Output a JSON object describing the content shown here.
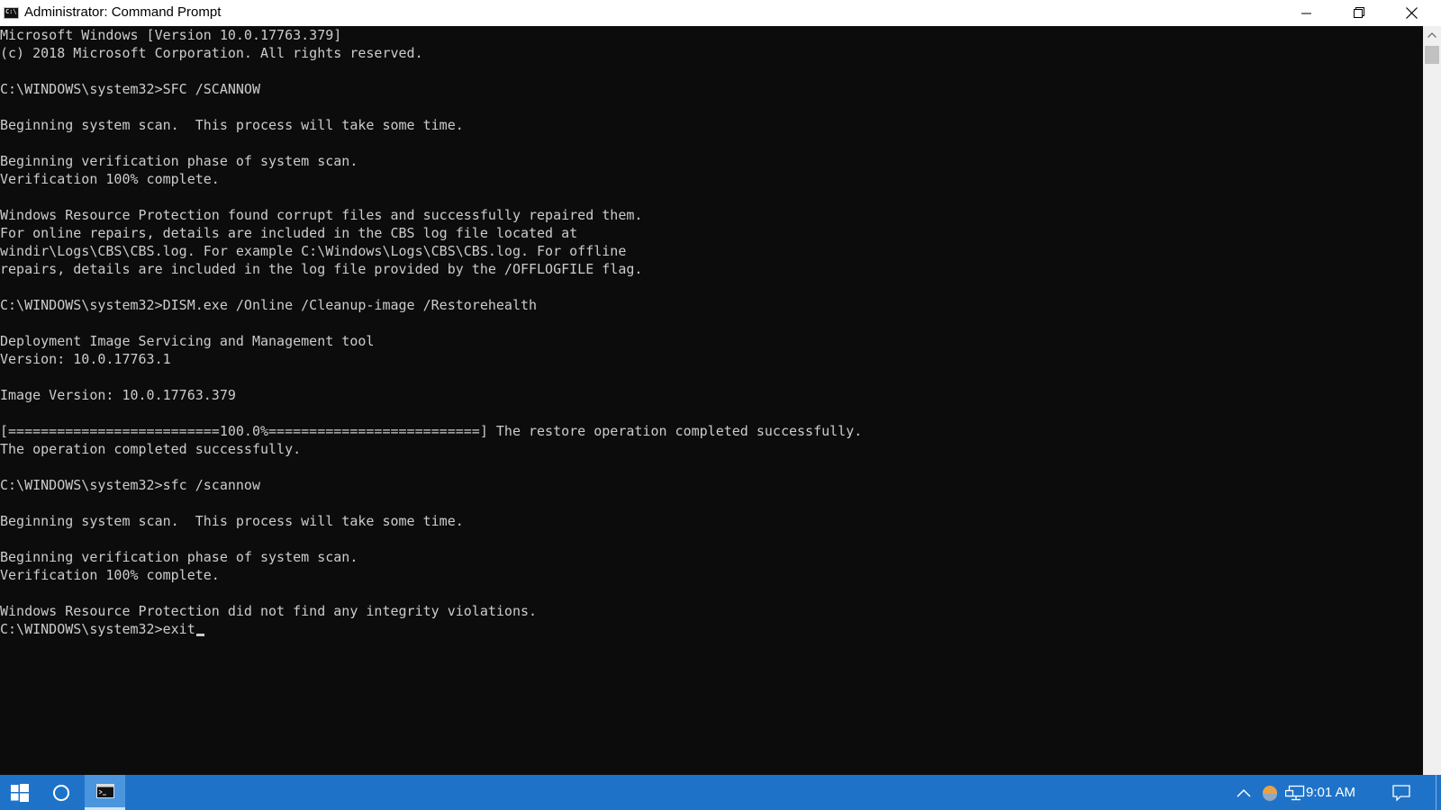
{
  "window": {
    "title": "Administrator: Command Prompt",
    "icon": "cmd-icon"
  },
  "console": {
    "lines": [
      "Microsoft Windows [Version 10.0.17763.379]",
      "(c) 2018 Microsoft Corporation. All rights reserved.",
      "",
      "C:\\WINDOWS\\system32>SFC /SCANNOW",
      "",
      "Beginning system scan.  This process will take some time.",
      "",
      "Beginning verification phase of system scan.",
      "Verification 100% complete.",
      "",
      "Windows Resource Protection found corrupt files and successfully repaired them.",
      "For online repairs, details are included in the CBS log file located at",
      "windir\\Logs\\CBS\\CBS.log. For example C:\\Windows\\Logs\\CBS\\CBS.log. For offline",
      "repairs, details are included in the log file provided by the /OFFLOGFILE flag.",
      "",
      "C:\\WINDOWS\\system32>DISM.exe /Online /Cleanup-image /Restorehealth",
      "",
      "Deployment Image Servicing and Management tool",
      "Version: 10.0.17763.1",
      "",
      "Image Version: 10.0.17763.379",
      "",
      "[==========================100.0%==========================] The restore operation completed successfully.",
      "The operation completed successfully.",
      "",
      "C:\\WINDOWS\\system32>sfc /scannow",
      "",
      "Beginning system scan.  This process will take some time.",
      "",
      "Beginning verification phase of system scan.",
      "Verification 100% complete.",
      "",
      "Windows Resource Protection did not find any integrity violations.",
      ""
    ],
    "current_input": "C:\\WINDOWS\\system32>exit",
    "text_color": "#cccccc",
    "background": "#0c0c0c"
  },
  "taskbar": {
    "clock": "9:01 AM",
    "accent": "#1e73c8"
  }
}
